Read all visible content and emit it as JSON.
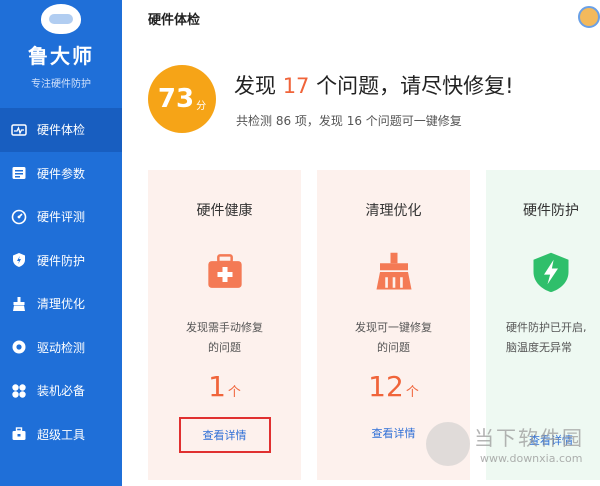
{
  "app": {
    "brand_name": "鲁大师",
    "brand_sub": "专注硬件防护"
  },
  "sidebar": {
    "items": [
      {
        "label": "硬件体检",
        "icon": "health-check-icon",
        "active": true
      },
      {
        "label": "硬件参数",
        "icon": "parameters-icon",
        "active": false
      },
      {
        "label": "硬件评测",
        "icon": "benchmark-icon",
        "active": false
      },
      {
        "label": "硬件防护",
        "icon": "shield-icon",
        "active": false
      },
      {
        "label": "清理优化",
        "icon": "broom-icon",
        "active": false
      },
      {
        "label": "驱动检测",
        "icon": "driver-icon",
        "active": false
      },
      {
        "label": "装机必备",
        "icon": "apps-icon",
        "active": false
      },
      {
        "label": "超级工具",
        "icon": "toolbox-icon",
        "active": false
      }
    ]
  },
  "header": {
    "title": "硬件体检"
  },
  "score": {
    "value": "73",
    "unit": "分"
  },
  "headline": {
    "prefix": "发现 ",
    "count": "17",
    "suffix": " 个问题，请尽快修复!"
  },
  "summary": "共检测 86 项，发现 16 个问题可一键修复",
  "cards": [
    {
      "title": "硬件健康",
      "icon": "first-aid-icon",
      "desc": "发现需手动修复\n的问题",
      "count": "1",
      "unit": "个",
      "link": "查看详情"
    },
    {
      "title": "清理优化",
      "icon": "broom-icon",
      "desc": "发现可一键修复\n的问题",
      "count": "12",
      "unit": "个",
      "link": "查看详情"
    },
    {
      "title": "硬件防护",
      "icon": "shield-bolt-icon",
      "desc": "硬件防护已开启,\n脑温度无异常",
      "link": "查看详情"
    }
  ],
  "watermark": {
    "text": "当下软件园",
    "url": "www.downxia.com"
  },
  "colors": {
    "sidebar": "#1f6fd8",
    "accent": "#f0643a",
    "score": "#f6a417",
    "link": "#2f6fd6",
    "protect": "#2fbf6b"
  }
}
